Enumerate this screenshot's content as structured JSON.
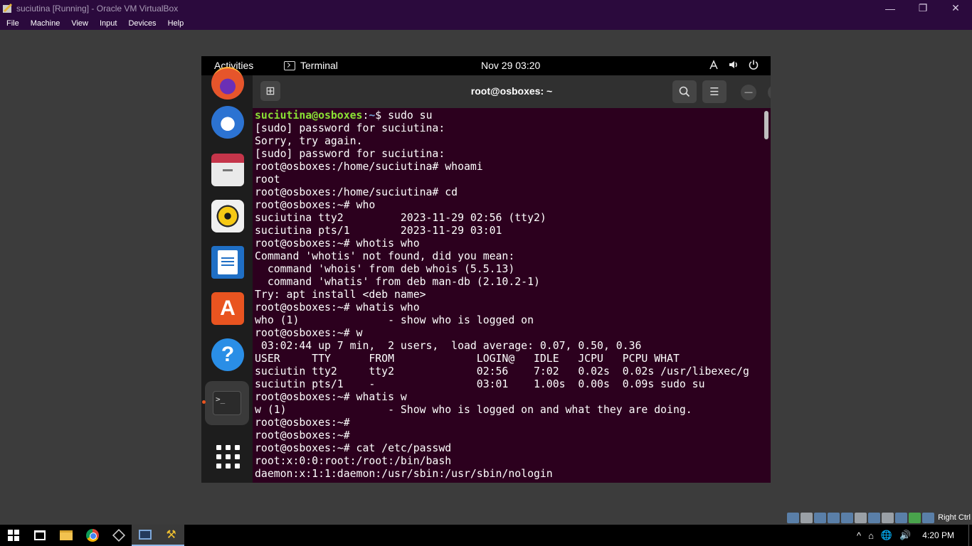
{
  "vbox": {
    "title": "suciutina [Running] - Oracle VM VirtualBox",
    "minimize_glyph": "—",
    "restore_glyph": "❐",
    "close_glyph": "✕",
    "menu": [
      "File",
      "Machine",
      "View",
      "Input",
      "Devices",
      "Help"
    ],
    "status_icons": [
      "hard-disk-icon",
      "optical-drive-icon",
      "audio-icon",
      "network-icon",
      "usb-icon",
      "shared-folders-icon",
      "display-icon",
      "recording-icon",
      "cpu-icon",
      "mouse-integration-icon",
      "keyboard-icon"
    ],
    "host_key": "Right Ctrl"
  },
  "gnome": {
    "activities": "Activities",
    "app_name": "Terminal",
    "clock": "Nov 29  03:20",
    "tray_icons": [
      "network-icon",
      "volume-icon",
      "power-icon"
    ]
  },
  "dock": {
    "apps": [
      "firefox-icon",
      "thunderbird-icon",
      "files-icon",
      "rhythmbox-icon",
      "libreoffice-writer-icon",
      "ubuntu-software-icon",
      "help-icon",
      "terminal-icon",
      "show-apps-icon"
    ],
    "software_glyph": "A",
    "help_glyph": "?",
    "terminal_glyph": ">_"
  },
  "terminal": {
    "title": "root@osboxes: ~",
    "newtab_glyph": "⊞",
    "search_glyph": "⌕",
    "menu_glyph": "☰",
    "minimize_glyph": "—",
    "maximize_glyph": "❐",
    "close_glyph": "✕",
    "lines": [
      {
        "user": "suciutina@osboxes",
        "path": "~",
        "sym": "$",
        "cmd": " sudo su"
      },
      {
        "text": "[sudo] password for suciutina:"
      },
      {
        "text": "Sorry, try again."
      },
      {
        "text": "[sudo] password for suciutina:"
      },
      {
        "text": "root@osboxes:/home/suciutina# whoami"
      },
      {
        "text": "root"
      },
      {
        "text": "root@osboxes:/home/suciutina# cd"
      },
      {
        "text": "root@osboxes:~# who"
      },
      {
        "text": "suciutina tty2         2023-11-29 02:56 (tty2)"
      },
      {
        "text": "suciutina pts/1        2023-11-29 03:01"
      },
      {
        "text": "root@osboxes:~# whotis who"
      },
      {
        "text": "Command 'whotis' not found, did you mean:"
      },
      {
        "text": "  command 'whois' from deb whois (5.5.13)"
      },
      {
        "text": "  command 'whatis' from deb man-db (2.10.2-1)"
      },
      {
        "text": "Try: apt install <deb name>"
      },
      {
        "text": "root@osboxes:~# whatis who"
      },
      {
        "text": "who (1)              - show who is logged on"
      },
      {
        "text": "root@osboxes:~# w"
      },
      {
        "text": " 03:02:44 up 7 min,  2 users,  load average: 0.07, 0.50, 0.36"
      },
      {
        "text": "USER     TTY      FROM             LOGIN@   IDLE   JCPU   PCPU WHAT"
      },
      {
        "text": "suciutin tty2     tty2             02:56    7:02   0.02s  0.02s /usr/libexec/g"
      },
      {
        "text": "suciutin pts/1    -                03:01    1.00s  0.00s  0.09s sudo su"
      },
      {
        "text": "root@osboxes:~# whatis w"
      },
      {
        "text": "w (1)                - Show who is logged on and what they are doing."
      },
      {
        "text": "root@osboxes:~#"
      },
      {
        "text": "root@osboxes:~#"
      },
      {
        "text": "root@osboxes:~# cat /etc/passwd"
      },
      {
        "text": "root:x:0:0:root:/root:/bin/bash"
      },
      {
        "text": "daemon:x:1:1:daemon:/usr/sbin:/usr/sbin/nologin"
      }
    ]
  },
  "taskbar": {
    "apps": [
      "windows-start-icon",
      "task-view-icon",
      "file-explorer-icon",
      "chrome-icon",
      "virtualbox-manager-icon",
      "virtualbox-vm-icon",
      "tools-icon"
    ],
    "tray_icons": [
      "tray-overflow-icon",
      "meet-now-icon",
      "network-globe-icon",
      "speaker-icon"
    ],
    "overflow_glyph": "^",
    "meet_glyph": "⌂",
    "network_glyph": "🌐",
    "speaker_glyph": "🔊",
    "tools_glyph": "⚒",
    "time": "4:20 PM"
  }
}
